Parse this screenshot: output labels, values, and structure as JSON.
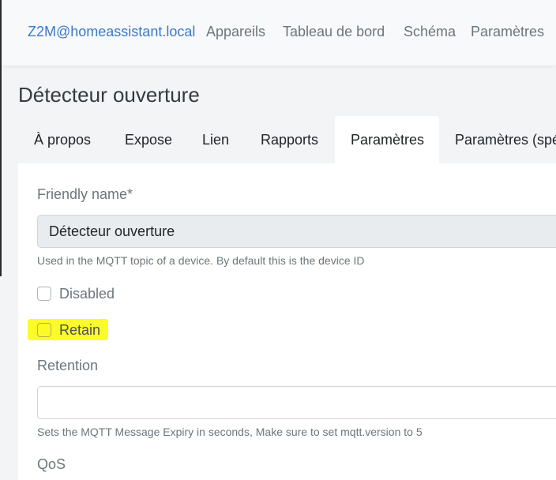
{
  "header": {
    "brand": "Z2M@homeassistant.local",
    "nav": [
      "Appareils",
      "Tableau de bord",
      "Schéma",
      "Paramètres"
    ]
  },
  "page": {
    "title": "Détecteur ouverture",
    "tabs": [
      "À propos",
      "Expose",
      "Lien",
      "Rapports",
      "Paramètres",
      "Paramètres (spé"
    ],
    "active_tab": "Paramètres"
  },
  "form": {
    "friendly_name": {
      "label": "Friendly name*",
      "value": "Détecteur ouverture",
      "help": "Used in the MQTT topic of a device. By default this is the device ID"
    },
    "disabled": {
      "label": "Disabled",
      "checked": false
    },
    "retain": {
      "label": "Retain",
      "checked": false,
      "highlight_color": "#fbfb2a"
    },
    "retention": {
      "label": "Retention",
      "value": "",
      "help": "Sets the MQTT Message Expiry in seconds, Make sure to set mqtt.version to 5"
    },
    "qos": {
      "label": "QoS"
    }
  },
  "colors": {
    "brand": "#3b78c9",
    "nav_text": "#6c757d",
    "page_bg": "#f3f4f6",
    "panel_bg": "#ffffff",
    "readonly_input_bg": "#e9ecef"
  }
}
